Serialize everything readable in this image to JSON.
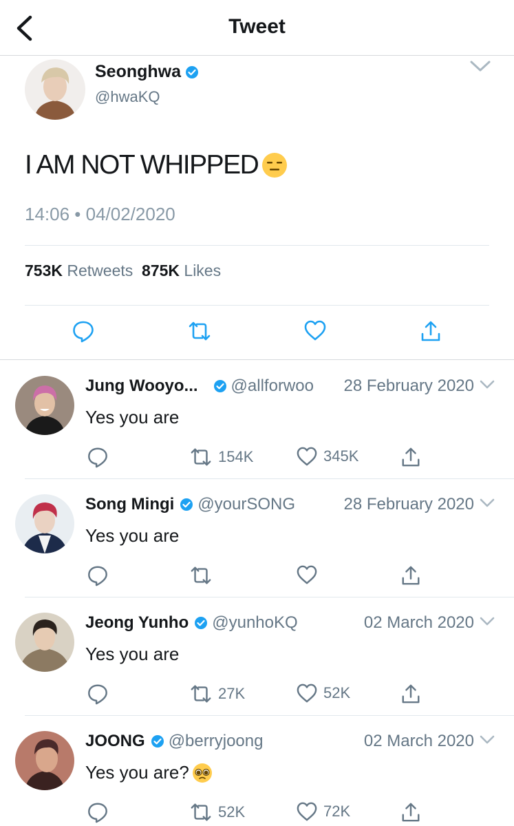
{
  "header": {
    "title": "Tweet"
  },
  "main": {
    "name": "Seonghwa",
    "handle": "@hwaKQ",
    "text": "I AM NOT WHIPPED",
    "timestamp": "14:06 • 04/02/2020",
    "retweets_count": "753K",
    "retweets_label": "Retweets",
    "likes_count": "875K",
    "likes_label": "Likes"
  },
  "replies": [
    {
      "name": "Jung Wooyo...",
      "handle": "@allforwoo",
      "date": "28 February 2020",
      "text": "Yes you are",
      "retweets": "154K",
      "likes": "345K"
    },
    {
      "name": "Song Mingi",
      "handle": "@yourSONG",
      "date": "28 February 2020",
      "text": "Yes you are",
      "retweets": "",
      "likes": ""
    },
    {
      "name": "Jeong Yunho",
      "handle": "@yunhoKQ",
      "date": "02 March 2020",
      "text": "Yes you are",
      "retweets": "27K",
      "likes": "52K"
    },
    {
      "name": "JOONG",
      "handle": "@berryjoong",
      "date": "02 March 2020",
      "text": "Yes you are?",
      "retweets": "52K",
      "likes": "72K"
    }
  ],
  "colors": {
    "accent": "#1da1f2",
    "muted": "#657786",
    "icon": "#1da1f2",
    "divider": "#e1e8ed"
  }
}
